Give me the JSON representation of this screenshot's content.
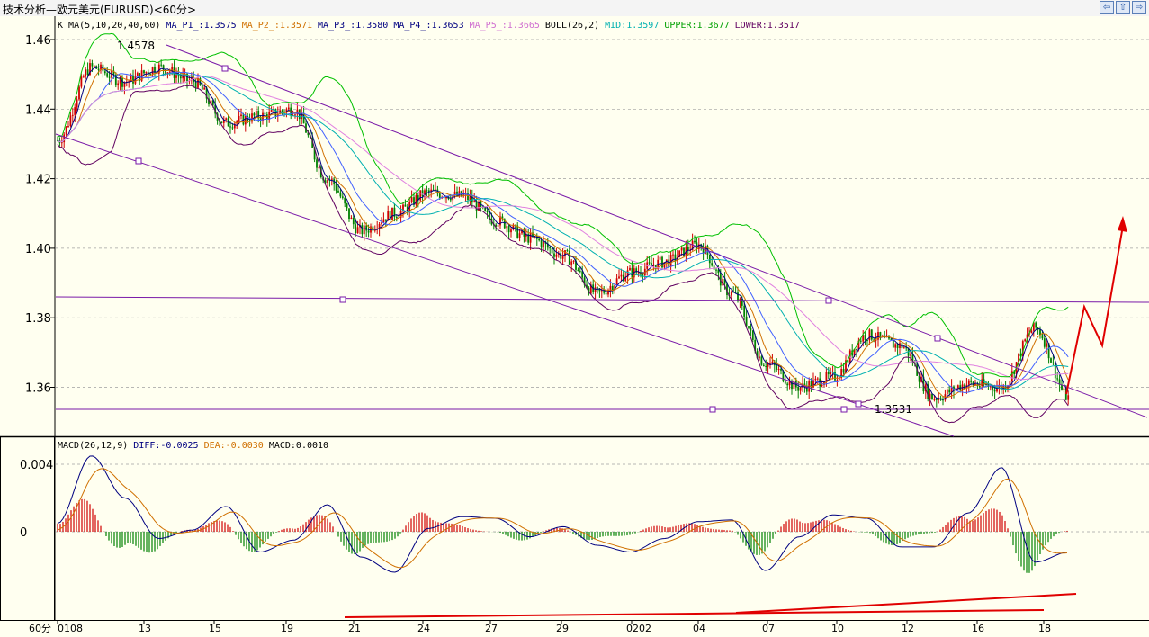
{
  "window": {
    "title": "技术分析—欧元美元(EURUSD)<60分>",
    "buttons": [
      "⇦",
      "⇧",
      "⇨"
    ]
  },
  "price_panel": {
    "legend": [
      {
        "text": "K",
        "color": "#000000"
      },
      {
        "text": "MA(5,10,20,40,60)",
        "color": "#000000"
      },
      {
        "text": "MA_P1_:1.3575",
        "color": "#000080"
      },
      {
        "text": "MA_P2_:1.3571",
        "color": "#d07000"
      },
      {
        "text": "MA_P3_:1.3580",
        "color": "#000080"
      },
      {
        "text": "MA_P4_:1.3653",
        "color": "#000080"
      },
      {
        "text": "MA_P5_:1.3665",
        "color": "#d070d0"
      },
      {
        "text": "BOLL(26,2)",
        "color": "#000000"
      },
      {
        "text": "MID:1.3597",
        "color": "#00b0b0"
      },
      {
        "text": "UPPER:1.3677",
        "color": "#00a000"
      },
      {
        "text": "LOWER:1.3517",
        "color": "#600060"
      }
    ],
    "high_label": "1.4578",
    "low_label": "1.3531"
  },
  "macd_panel": {
    "legend": [
      {
        "text": "MACD(26,12,9)",
        "color": "#000000"
      },
      {
        "text": "DIFF:-0.0025",
        "color": "#000080"
      },
      {
        "text": "DEA:-0.0030",
        "color": "#d07000"
      },
      {
        "text": "MACD:0.0010",
        "color": "#000000"
      }
    ]
  },
  "x_axis": {
    "period_label": "60分",
    "ticks": [
      "0108",
      "13",
      "15",
      "19",
      "21",
      "24",
      "27",
      "29",
      "0202",
      "04",
      "07",
      "10",
      "12",
      "16",
      "18"
    ]
  },
  "colors": {
    "up": "#d00000",
    "down": "#008000",
    "ma1": "#000080",
    "ma2": "#d07000",
    "ma3": "#4060ff",
    "ma4": "#00b0b0",
    "ma5": "#e080e0",
    "boll_upper": "#00c000",
    "boll_lower": "#600060",
    "channel": "#7a1aa8",
    "arrow": "#e00000",
    "grid": "#a0a0a0"
  },
  "chart_data": {
    "type": "candlestick",
    "price_axis": {
      "ylim": [
        1.349,
        1.468
      ],
      "ticks": [
        "1.46",
        "1.44",
        "1.42",
        "1.40",
        "1.38",
        "1.36"
      ]
    },
    "macd_axis": {
      "ylim": [
        -0.0025,
        0.0048
      ],
      "ticks": [
        "0.004",
        "0"
      ]
    },
    "close_path": [
      {
        "x": "01-08",
        "y": 1.431
      },
      {
        "x": "01-09",
        "y": 1.452
      },
      {
        "x": "01-13",
        "y": 1.448
      },
      {
        "x": "01-14",
        "y": 1.452
      },
      {
        "x": "01-15",
        "y": 1.448
      },
      {
        "x": "01-16",
        "y": 1.436
      },
      {
        "x": "01-17",
        "y": 1.438
      },
      {
        "x": "01-19",
        "y": 1.44
      },
      {
        "x": "01-20",
        "y": 1.42
      },
      {
        "x": "01-21",
        "y": 1.405
      },
      {
        "x": "01-22",
        "y": 1.41
      },
      {
        "x": "01-24",
        "y": 1.416
      },
      {
        "x": "01-26",
        "y": 1.415
      },
      {
        "x": "01-27",
        "y": 1.408
      },
      {
        "x": "01-28",
        "y": 1.403
      },
      {
        "x": "01-29",
        "y": 1.398
      },
      {
        "x": "01-30",
        "y": 1.387
      },
      {
        "x": "02-02",
        "y": 1.393
      },
      {
        "x": "02-03",
        "y": 1.396
      },
      {
        "x": "02-04",
        "y": 1.401
      },
      {
        "x": "02-05",
        "y": 1.387
      },
      {
        "x": "02-06",
        "y": 1.367
      },
      {
        "x": "02-07",
        "y": 1.36
      },
      {
        "x": "02-08",
        "y": 1.363
      },
      {
        "x": "02-10",
        "y": 1.375
      },
      {
        "x": "02-11",
        "y": 1.372
      },
      {
        "x": "02-12",
        "y": 1.357
      },
      {
        "x": "02-14",
        "y": 1.361
      },
      {
        "x": "02-16",
        "y": 1.36
      },
      {
        "x": "02-17",
        "y": 1.377
      },
      {
        "x": "02-18",
        "y": 1.357
      }
    ]
  }
}
